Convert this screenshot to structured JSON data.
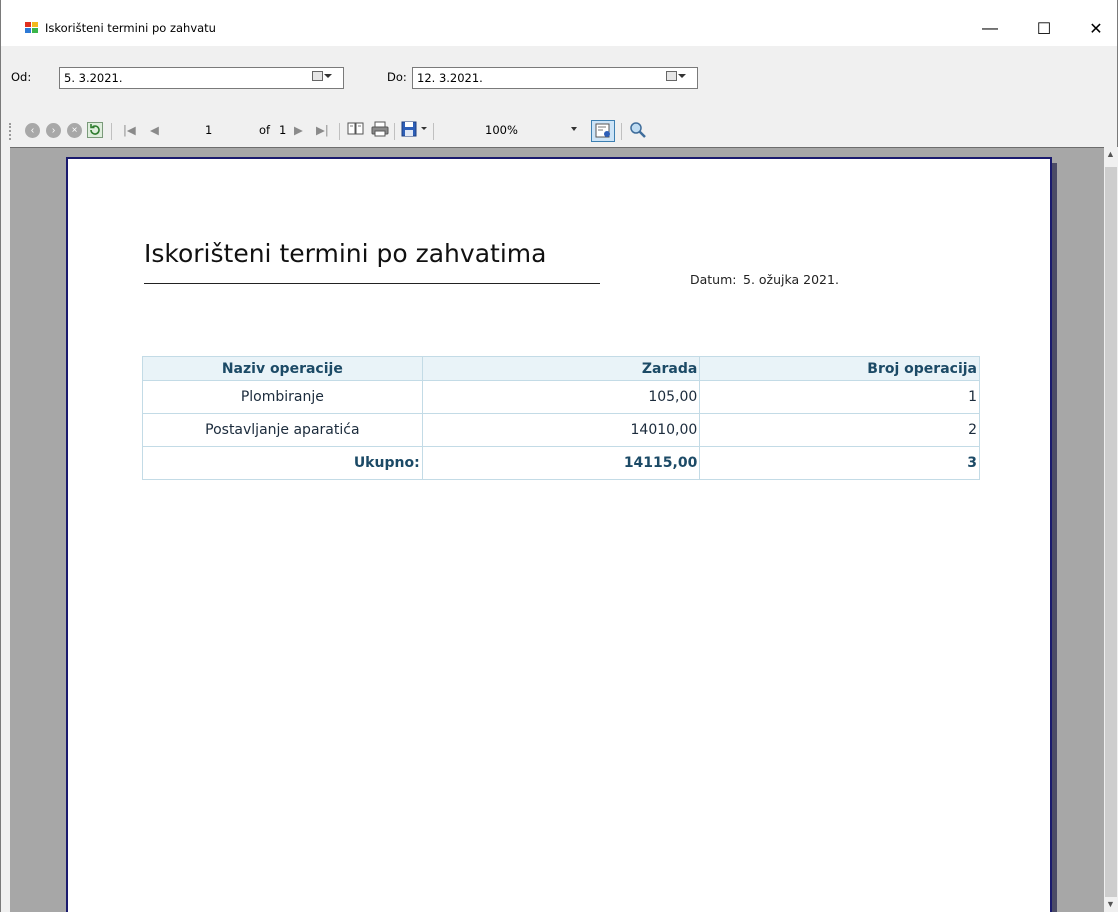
{
  "window": {
    "title": "Iskorišteni termini po zahvatu",
    "minimize": "—",
    "maximize": "☐",
    "close": "✕"
  },
  "filters": {
    "from_label": "Od:",
    "from_value": "5. 3.2021.",
    "to_label": "Do:",
    "to_value": "12. 3.2021."
  },
  "toolbar": {
    "current_page": "1",
    "of_label": "of",
    "total_pages": "1",
    "zoom": "100%",
    "icons": [
      "back-icon",
      "forward-icon",
      "stop-icon",
      "refresh-icon",
      "first-page-icon",
      "previous-page-icon",
      "next-page-icon",
      "last-page-icon",
      "print-layout-icon",
      "print-icon",
      "save-icon",
      "page-setup-icon",
      "find-icon"
    ]
  },
  "report": {
    "title": "Iskorišteni termini po zahvatima",
    "date_label": "Datum:",
    "date_value": "5. ožujka 2021.",
    "columns": [
      "Naziv operacije",
      "Zarada",
      "Broj operacija"
    ],
    "rows": [
      {
        "name": "Plombiranje",
        "earnings": "105,00",
        "count": "1"
      },
      {
        "name": "Postavljanje aparatića",
        "earnings": "14010,00",
        "count": "2"
      }
    ],
    "total": {
      "label": "Ukupno:",
      "earnings": "14115,00",
      "count": "3"
    }
  },
  "colors": {
    "header_bg": "#e9f3f8",
    "header_text": "#1c4a66",
    "cell_border": "#c3dbe6",
    "page_border": "#1a1a6e"
  }
}
